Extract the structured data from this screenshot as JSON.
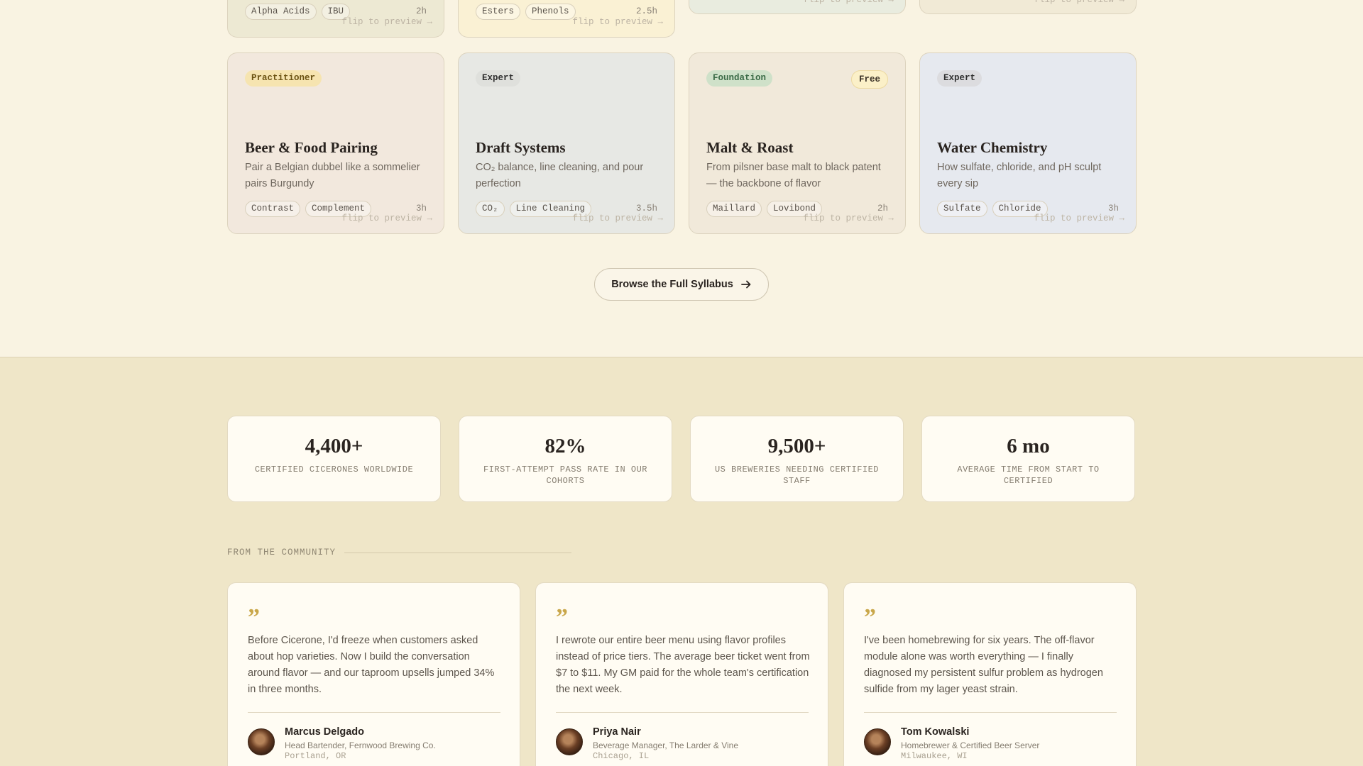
{
  "top_cards": [
    {
      "tags": [
        "Alpha Acids",
        "IBU"
      ],
      "hours": "2h",
      "flip": "flip to preview →",
      "bg": "#ede9d3"
    },
    {
      "tags": [
        "Esters",
        "Phenols"
      ],
      "hours": "2.5h",
      "flip": "flip to preview →",
      "bg": "#faf1d4"
    },
    {
      "tags": [],
      "hours": "",
      "flip": "flip to preview →",
      "bg": "#e9ecdf"
    },
    {
      "tags": [],
      "hours": "",
      "flip": "flip to preview →",
      "bg": "#f1ead6"
    }
  ],
  "courses": [
    {
      "level": "Practitioner",
      "level_bg": "#f6e4b0",
      "level_color": "#6b5212",
      "free": "",
      "title": "Beer & Food Pairing",
      "desc": "Pair a Belgian dubbel like a sommelier pairs Burgundy",
      "tags": [
        "Contrast",
        "Complement"
      ],
      "hours": "3h",
      "flip": "flip to preview →",
      "bg": "#f2e8dd"
    },
    {
      "level": "Expert",
      "level_bg": "#dfe0dc",
      "level_color": "#2e2e2e",
      "free": "",
      "title": "Draft Systems",
      "desc": "CO₂ balance, line cleaning, and pour perfection",
      "tags": [
        "CO₂",
        "Line Cleaning"
      ],
      "hours": "3.5h",
      "flip": "flip to preview →",
      "bg": "#e7e8e4"
    },
    {
      "level": "Foundation",
      "level_bg": "#cfe1c9",
      "level_color": "#3a6a46",
      "free": "Free",
      "title": "Malt & Roast",
      "desc": "From pilsner base malt to black patent — the backbone of flavor",
      "tags": [
        "Maillard",
        "Lovibond"
      ],
      "hours": "2h",
      "flip": "flip to preview →",
      "bg": "#f1e9da"
    },
    {
      "level": "Expert",
      "level_bg": "#dcdcdf",
      "level_color": "#2e2e2e",
      "free": "",
      "title": "Water Chemistry",
      "desc": "How sulfate, chloride, and pH sculpt every sip",
      "tags": [
        "Sulfate",
        "Chloride"
      ],
      "hours": "3h",
      "flip": "flip to preview →",
      "bg": "#e6e9ef"
    }
  ],
  "browse_label": "Browse the Full Syllabus",
  "stats": [
    {
      "value": "4,400+",
      "label": "CERTIFIED CICERONES WORLDWIDE"
    },
    {
      "value": "82%",
      "label": "FIRST-ATTEMPT PASS RATE IN OUR COHORTS"
    },
    {
      "value": "9,500+",
      "label": "US BREWERIES NEEDING CERTIFIED STAFF"
    },
    {
      "value": "6 mo",
      "label": "AVERAGE TIME FROM START TO CERTIFIED"
    }
  ],
  "community_heading": "FROM THE COMMUNITY",
  "testimonials": [
    {
      "quote": "Before Cicerone, I'd freeze when customers asked about hop varieties. Now I build the conversation around flavor — and our taproom upsells jumped 34% in three months.",
      "name": "Marcus Delgado",
      "role": "Head Bartender, Fernwood Brewing Co.",
      "location": "Portland, OR"
    },
    {
      "quote": "I rewrote our entire beer menu using flavor profiles instead of price tiers. The average beer ticket went from $7 to $11. My GM paid for the whole team's certification the next week.",
      "name": "Priya Nair",
      "role": "Beverage Manager, The Larder & Vine",
      "location": "Chicago, IL"
    },
    {
      "quote": "I've been homebrewing for six years. The off-flavor module alone was worth everything — I finally diagnosed my persistent sulfur problem as hydrogen sulfide from my lager yeast strain.",
      "name": "Tom Kowalski",
      "role": "Homebrewer & Certified Beer Server",
      "location": "Milwaukee, WI"
    }
  ],
  "quote_mark": "”"
}
